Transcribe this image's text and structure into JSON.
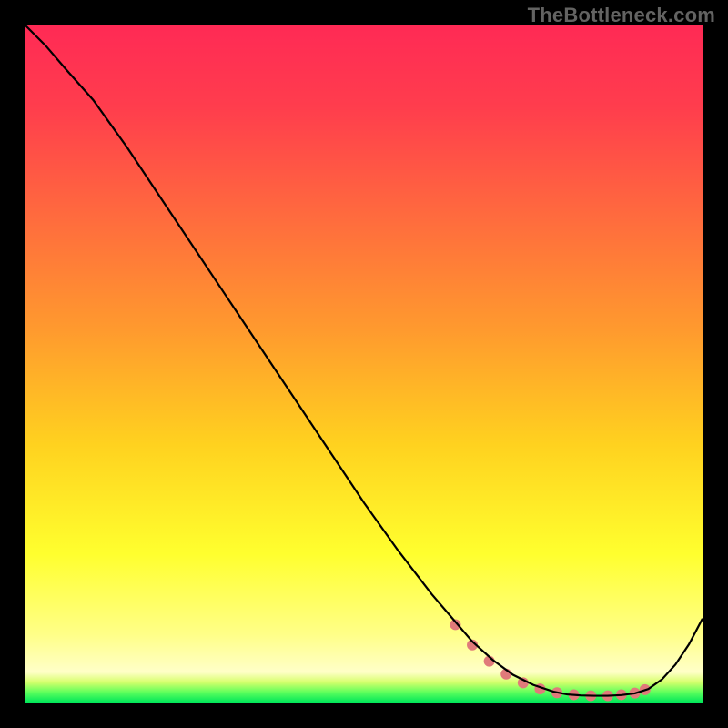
{
  "watermark": "TheBottleneck.com",
  "chart_data": {
    "type": "line",
    "title": "",
    "xlabel": "",
    "ylabel": "",
    "xlim": [
      0,
      100
    ],
    "ylim": [
      0,
      100
    ],
    "grid": false,
    "legend": false,
    "background_gradient_stops": [
      {
        "offset": 0.0,
        "color": "#ff2a55"
      },
      {
        "offset": 0.12,
        "color": "#ff3d4d"
      },
      {
        "offset": 0.28,
        "color": "#ff6a3e"
      },
      {
        "offset": 0.45,
        "color": "#ff9a2e"
      },
      {
        "offset": 0.62,
        "color": "#ffd21f"
      },
      {
        "offset": 0.78,
        "color": "#ffff2e"
      },
      {
        "offset": 0.9,
        "color": "#ffff88"
      },
      {
        "offset": 0.955,
        "color": "#ffffc8"
      },
      {
        "offset": 0.97,
        "color": "#d6ff6c"
      },
      {
        "offset": 0.985,
        "color": "#5cff5c"
      },
      {
        "offset": 1.0,
        "color": "#00e65a"
      }
    ],
    "series": [
      {
        "name": "curve",
        "color": "#000000",
        "stroke_width": 2.2,
        "x": [
          0,
          3,
          6,
          10,
          15,
          20,
          25,
          30,
          35,
          40,
          45,
          50,
          55,
          60,
          63,
          66,
          69,
          72,
          75,
          78,
          80,
          82,
          84,
          86,
          88,
          90,
          92,
          94,
          96,
          98,
          100
        ],
        "y": [
          100,
          97,
          93.5,
          89,
          82,
          74.5,
          67,
          59.5,
          52,
          44.5,
          37,
          29.5,
          22.5,
          16,
          12.5,
          9,
          6.3,
          4.1,
          2.6,
          1.6,
          1.2,
          1.05,
          1.0,
          1.0,
          1.1,
          1.35,
          2.0,
          3.4,
          5.6,
          8.6,
          12.4
        ]
      }
    ],
    "markers": {
      "name": "mask-band",
      "color": "#e07a7a",
      "radius_px": 6,
      "x": [
        63.5,
        66,
        68.5,
        71,
        73.5,
        76,
        78.5,
        81,
        83.5,
        86,
        88,
        90,
        91.5
      ],
      "y": [
        11.5,
        8.5,
        6.1,
        4.2,
        2.9,
        2.0,
        1.45,
        1.15,
        1.0,
        1.0,
        1.15,
        1.4,
        1.9
      ]
    }
  }
}
